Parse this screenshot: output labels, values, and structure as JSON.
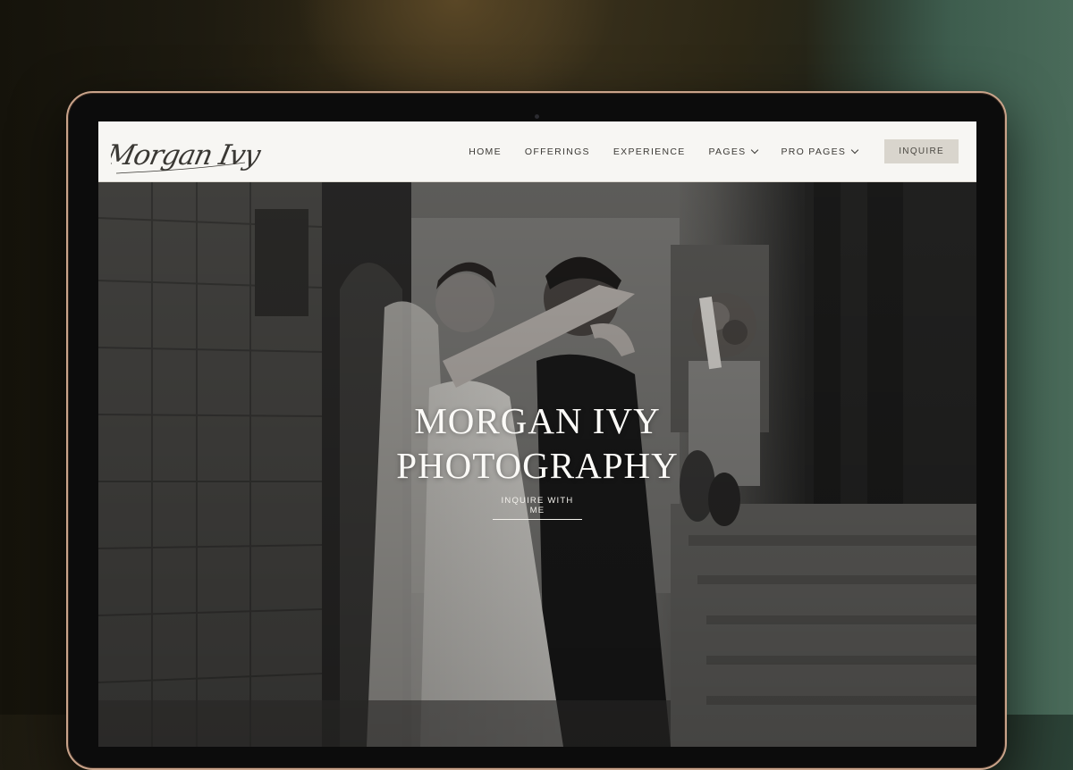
{
  "site": {
    "logo_text": "Morgan Ivy",
    "nav": [
      {
        "label": "HOME",
        "dropdown": false
      },
      {
        "label": "OFFERINGS",
        "dropdown": false
      },
      {
        "label": "EXPERIENCE",
        "dropdown": false
      },
      {
        "label": "PAGES",
        "dropdown": true
      },
      {
        "label": "PRO PAGES",
        "dropdown": true
      }
    ],
    "cta_label": "INQUIRE"
  },
  "hero": {
    "title_line1": "MORGAN IVY",
    "title_line2": "PHOTOGRAPHY",
    "link_label": "INQUIRE WITH ME"
  },
  "colors": {
    "header_bg": "#f7f6f3",
    "cta_bg": "#d9d5cd",
    "laptop_frame": "#c9a38a"
  }
}
